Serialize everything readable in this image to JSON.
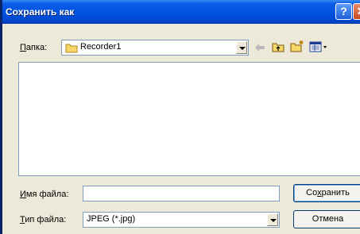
{
  "window": {
    "title": "Сохранить как",
    "help_icon": "?",
    "close_icon": "✕"
  },
  "folder": {
    "label_u": "П",
    "label_rest": "апка:",
    "value": "Recorder1"
  },
  "toolbar": {
    "back_icon": "back-arrow-icon",
    "up_icon": "up-folder-icon",
    "newfolder_icon": "new-folder-icon",
    "view_icon": "view-menu-icon"
  },
  "filename": {
    "label_u": "И",
    "label_rest": "мя файла:",
    "value": ""
  },
  "filetype": {
    "label_u": "Т",
    "label_rest": "ип файла:",
    "value": "JPEG (*.jpg)"
  },
  "buttons": {
    "save_pre": "Со",
    "save_u": "х",
    "save_post": "ранить",
    "cancel": "Отмена"
  }
}
